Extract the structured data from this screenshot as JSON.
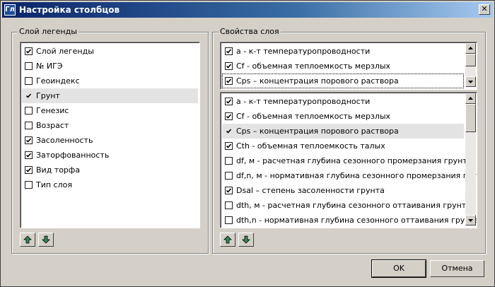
{
  "window": {
    "title": "Настройка столбцов",
    "icon_text": "Гл",
    "close_glyph": "✕"
  },
  "legend_group": {
    "title": "Слой легенды",
    "items": [
      {
        "label": "Слой легенды",
        "checked": true,
        "selected": false
      },
      {
        "label": "№ ИГЭ",
        "checked": false,
        "selected": false
      },
      {
        "label": "Геоиндекс",
        "checked": false,
        "selected": false
      },
      {
        "label": "Грунт",
        "checked": true,
        "selected": true
      },
      {
        "label": "Генезис",
        "checked": false,
        "selected": false
      },
      {
        "label": "Возраст",
        "checked": false,
        "selected": false
      },
      {
        "label": "Засоленность",
        "checked": true,
        "selected": false
      },
      {
        "label": "Заторфованность",
        "checked": true,
        "selected": false
      },
      {
        "label": "Вид торфа",
        "checked": true,
        "selected": false
      },
      {
        "label": "Тип слоя",
        "checked": false,
        "selected": false
      }
    ]
  },
  "props_group": {
    "title": "Свойства слоя",
    "top_items": [
      {
        "label": "a - к-т температуропроводности",
        "checked": true,
        "focused": false
      },
      {
        "label": "Cf - объемная теплоемкость мерзлых",
        "checked": true,
        "focused": false
      },
      {
        "label": "Cps – концентрация порового раствора",
        "checked": true,
        "focused": true
      }
    ],
    "bottom_items": [
      {
        "label": "a - к-т температуропроводности",
        "checked": true,
        "selected": false
      },
      {
        "label": "Cf - объемная теплоемкость мерзлых",
        "checked": true,
        "selected": false
      },
      {
        "label": "Cps – концентрация порового раствора",
        "checked": true,
        "selected": true
      },
      {
        "label": "Cth - объемная теплоемкость талых",
        "checked": true,
        "selected": false
      },
      {
        "label": "df, м - расчетная глубина сезонного промерзания грунта",
        "checked": false,
        "selected": false
      },
      {
        "label": "df,n, м - нормативная глубина сезонного промерзания грунта",
        "checked": false,
        "selected": false
      },
      {
        "label": "Dsal – степень засоленности грунта",
        "checked": true,
        "selected": false
      },
      {
        "label": "dth, м - расчетная глубина сезонного оттаивания грунта",
        "checked": false,
        "selected": false
      },
      {
        "label": "dth,n - нормативная глубина сезонного оттаивания грунта",
        "checked": false,
        "selected": false
      }
    ]
  },
  "buttons": {
    "ok": "OK",
    "cancel": "Отмена"
  },
  "colors": {
    "arrow_fill": "#2e8b57",
    "title_start": "#0a246a",
    "title_end": "#a6caf0"
  }
}
